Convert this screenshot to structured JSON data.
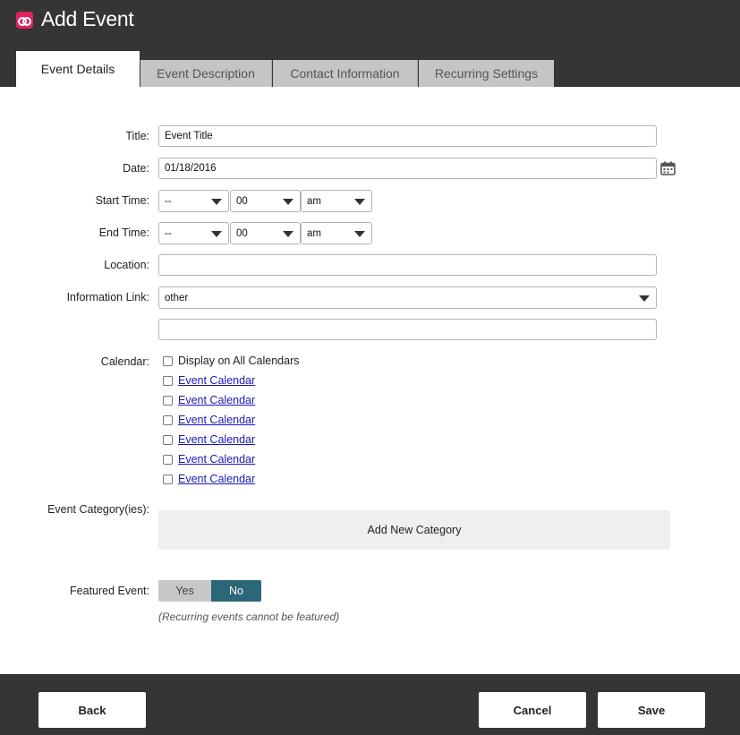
{
  "header": {
    "title": "Add Event",
    "logo_icon": "app-logo-icon"
  },
  "tabs": [
    {
      "label": "Event Details",
      "active": true
    },
    {
      "label": "Event Description",
      "active": false
    },
    {
      "label": "Contact Information",
      "active": false
    },
    {
      "label": "Recurring Settings",
      "active": false
    }
  ],
  "form": {
    "title": {
      "label": "Title:",
      "value": "Event Title"
    },
    "date": {
      "label": "Date:",
      "value": "01/18/2016",
      "icon": "calendar-icon"
    },
    "start_time": {
      "label": "Start Time:",
      "hour": "--",
      "minute": "00",
      "meridiem": "am"
    },
    "end_time": {
      "label": "End Time:",
      "hour": "--",
      "minute": "00",
      "meridiem": "am"
    },
    "location": {
      "label": "Location:",
      "value": ""
    },
    "info_link": {
      "label": "Information Link:",
      "selected": "other",
      "url_value": ""
    },
    "calendar": {
      "label": "Calendar:",
      "all_label": "Display on All Calendars",
      "items": [
        "Event Calendar",
        "Event Calendar",
        "Event Calendar",
        "Event Calendar",
        "Event Calendar",
        "Event Calendar"
      ]
    },
    "category": {
      "label": "Event Category(ies):",
      "add_label": "Add New Category"
    },
    "featured": {
      "label": "Featured Event:",
      "yes": "Yes",
      "no": "No",
      "selected": "No",
      "note": "(Recurring events cannot be featured)"
    }
  },
  "footer": {
    "back": "Back",
    "cancel": "Cancel",
    "save": "Save"
  },
  "colors": {
    "header_bg": "#353535",
    "accent": "#e0245e",
    "toggle_active": "#2b6777",
    "link": "#1a1ab8"
  }
}
